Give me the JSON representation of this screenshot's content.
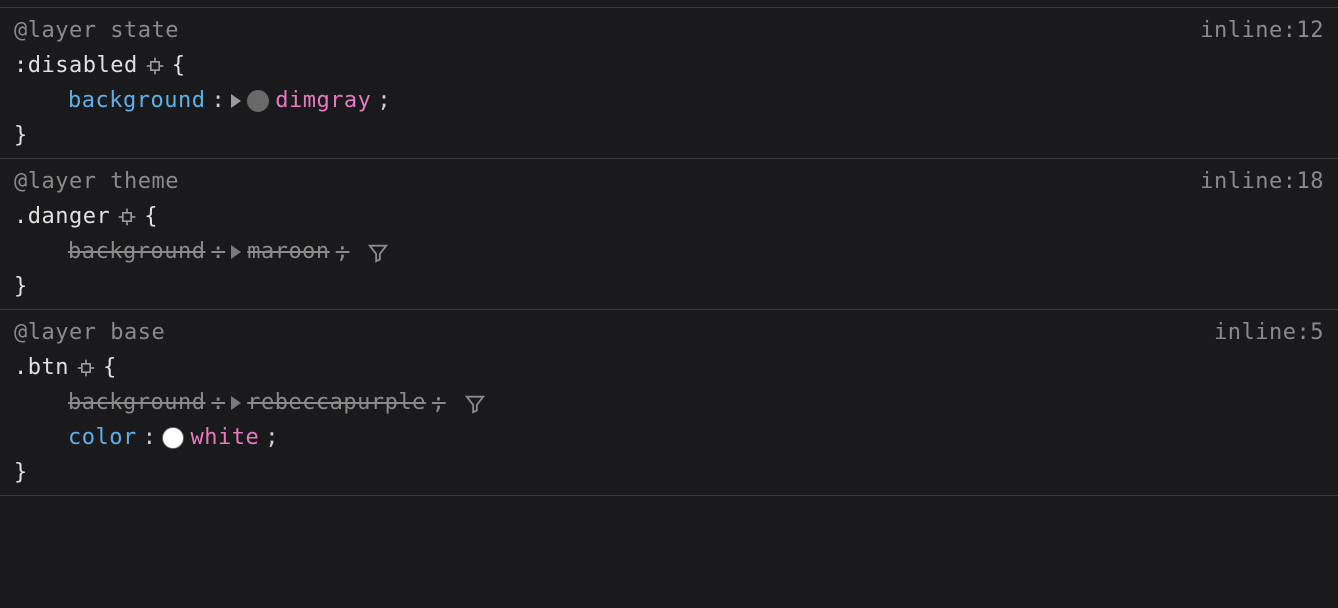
{
  "rules": [
    {
      "layer_label": "@layer state",
      "source": "inline:12",
      "selector": ":disabled",
      "open_brace": "{",
      "close_brace": "}",
      "decls": [
        {
          "prop": "background",
          "colon": ":",
          "value": "dimgray",
          "semi": ";",
          "overridden": false,
          "swatch": "#696969",
          "show_swatch": true,
          "show_tri": true
        }
      ]
    },
    {
      "layer_label": "@layer theme",
      "source": "inline:18",
      "selector": ".danger",
      "open_brace": "{",
      "close_brace": "}",
      "decls": [
        {
          "prop": "background",
          "colon": ":",
          "value": "maroon",
          "semi": ";",
          "overridden": true,
          "swatch": "#800000",
          "show_swatch": false,
          "show_tri": true
        }
      ]
    },
    {
      "layer_label": "@layer base",
      "source": "inline:5",
      "selector": ".btn",
      "open_brace": "{",
      "close_brace": "}",
      "decls": [
        {
          "prop": "background",
          "colon": ":",
          "value": "rebeccapurple",
          "semi": ";",
          "overridden": true,
          "swatch": "#663399",
          "show_swatch": false,
          "show_tri": true
        },
        {
          "prop": "color",
          "colon": ":",
          "value": "white",
          "semi": ";",
          "overridden": false,
          "swatch": "#ffffff",
          "show_swatch": true,
          "show_tri": false
        }
      ]
    }
  ]
}
